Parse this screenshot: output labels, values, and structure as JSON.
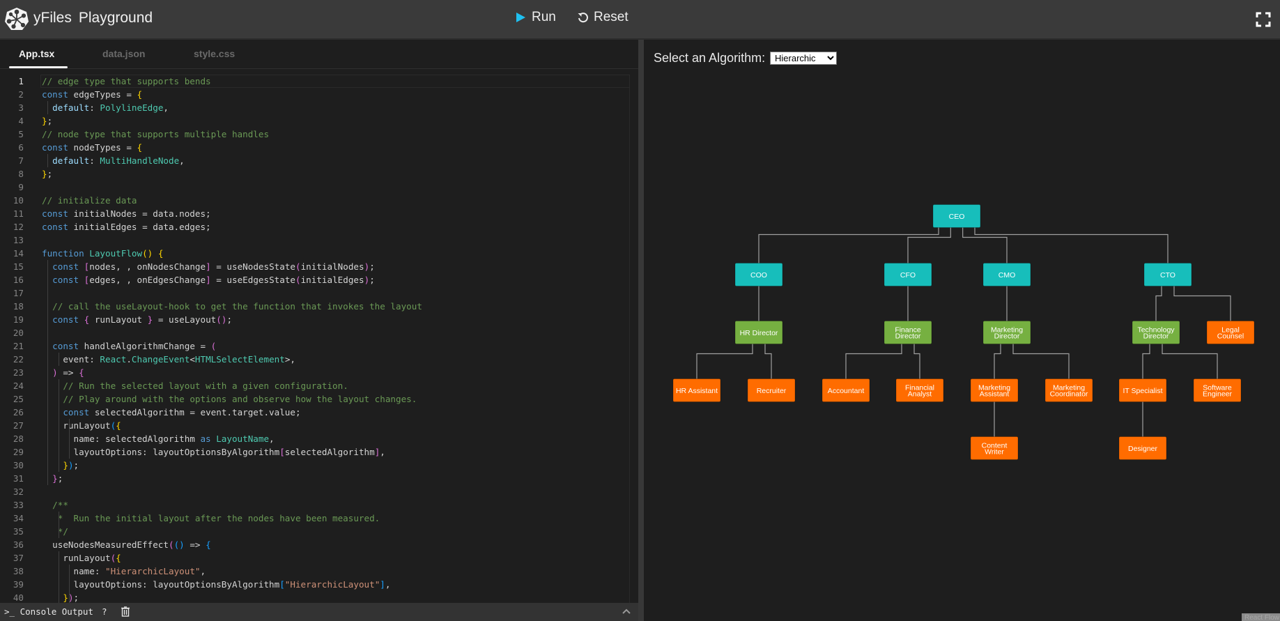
{
  "header": {
    "brand_part1": "yFiles",
    "brand_part2": "Playground",
    "run_label": "Run",
    "reset_label": "Reset",
    "logo_icon": "yfiles-logo-icon",
    "run_icon": "play-icon",
    "reset_icon": "reset-icon",
    "fullscreen_icon": "fullscreen-icon"
  },
  "editor": {
    "tabs": [
      {
        "label": "App.tsx",
        "active": true
      },
      {
        "label": "data.json",
        "active": false
      },
      {
        "label": "style.css",
        "active": false
      }
    ],
    "current_line": 1,
    "lines": [
      [
        [
          "c-com",
          "// edge type that supports bends"
        ]
      ],
      [
        [
          "c-kw",
          "const"
        ],
        [
          "",
          "edgeTypes = "
        ],
        [
          "c-b1",
          "{"
        ]
      ],
      [
        [
          "",
          "  "
        ],
        [
          "c-var",
          "default"
        ],
        [
          "",
          ": "
        ],
        [
          "c-type",
          "PolylineEdge"
        ],
        [
          "",
          ","
        ]
      ],
      [
        [
          "c-b1",
          "}"
        ],
        [
          "",
          ";"
        ]
      ],
      [
        [
          "c-com",
          "// node type that supports multiple handles"
        ]
      ],
      [
        [
          "c-kw",
          "const"
        ],
        [
          "",
          "nodeTypes = "
        ],
        [
          "c-b1",
          "{"
        ]
      ],
      [
        [
          "",
          "  "
        ],
        [
          "c-var",
          "default"
        ],
        [
          "",
          ": "
        ],
        [
          "c-type",
          "MultiHandleNode"
        ],
        [
          "",
          ","
        ]
      ],
      [
        [
          "c-b1",
          "}"
        ],
        [
          "",
          ";"
        ]
      ],
      [],
      [
        [
          "c-com",
          "// initialize data"
        ]
      ],
      [
        [
          "c-kw",
          "const"
        ],
        [
          "",
          "initialNodes = data.nodes;"
        ]
      ],
      [
        [
          "c-kw",
          "const"
        ],
        [
          "",
          "initialEdges = data.edges;"
        ]
      ],
      [],
      [
        [
          "c-kw",
          "function"
        ],
        [
          "c-type",
          " LayoutFlow"
        ],
        [
          "c-b1",
          "()"
        ],
        [
          "",
          ""
        ],
        [
          "c-b1",
          " {"
        ]
      ],
      [
        [
          "",
          "  "
        ],
        [
          "c-kw",
          "const"
        ],
        [
          "c-b2",
          " ["
        ],
        [
          "",
          "nodes, , onNodesChange"
        ],
        [
          "c-b2",
          "]"
        ],
        [
          "",
          "",
          " = useNodesState"
        ],
        [
          "c-b2",
          "("
        ],
        [
          "",
          "initialNodes"
        ],
        [
          "c-b2",
          ")"
        ],
        [
          "",
          ";"
        ]
      ],
      [
        [
          "",
          "  "
        ],
        [
          "c-kw",
          "const"
        ],
        [
          "c-b2",
          " ["
        ],
        [
          "",
          "edges, , onEdgesChange"
        ],
        [
          "c-b2",
          "]"
        ],
        [
          "",
          "",
          " = useEdgesState"
        ],
        [
          "c-b2",
          "("
        ],
        [
          "",
          "initialEdges"
        ],
        [
          "c-b2",
          ")"
        ],
        [
          "",
          ";"
        ]
      ],
      [],
      [
        [
          "",
          "  "
        ],
        [
          "c-com",
          "// call the useLayout-hook to get the function that invokes the layout"
        ]
      ],
      [
        [
          "",
          "  "
        ],
        [
          "c-kw",
          "const"
        ],
        [
          "c-b2",
          " {"
        ],
        [
          "",
          " runLayout "
        ],
        [
          "c-b2",
          "}"
        ],
        [
          "",
          " = useLayout"
        ],
        [
          "c-b2",
          "()"
        ],
        [
          "",
          ";"
        ]
      ],
      [],
      [
        [
          "",
          "  "
        ],
        [
          "c-kw",
          "const"
        ],
        [
          "",
          " handleAlgorithmChange = "
        ],
        [
          "c-b2",
          "("
        ]
      ],
      [
        [
          "",
          "    event: "
        ],
        [
          "c-type",
          "React"
        ],
        [
          "",
          "."
        ],
        [
          "c-type",
          "ChangeEvent"
        ],
        [
          "",
          "<"
        ],
        [
          "c-type",
          "HTMLSelectElement"
        ],
        [
          "",
          ">,"
        ]
      ],
      [
        [
          "",
          "  "
        ],
        [
          "c-b2",
          ")"
        ],
        [
          "",
          " => "
        ],
        [
          "c-b2",
          "{"
        ]
      ],
      [
        [
          "",
          "    "
        ],
        [
          "c-com",
          "// Run the selected layout with a given configuration."
        ]
      ],
      [
        [
          "",
          "    "
        ],
        [
          "c-com",
          "// Play around with the options and observe how the layout changes."
        ]
      ],
      [
        [
          "",
          "    "
        ],
        [
          "c-kw",
          "const"
        ],
        [
          "",
          " selectedAlgorithm = event.target.value;"
        ]
      ],
      [
        [
          "",
          "    runLayout"
        ],
        [
          "c-b3",
          "("
        ],
        [
          "c-b1",
          "{"
        ]
      ],
      [
        [
          "",
          "      name: selectedAlgorithm "
        ],
        [
          "c-kw",
          "as"
        ],
        [
          "c-type",
          " LayoutName"
        ],
        [
          "",
          ","
        ]
      ],
      [
        [
          "",
          "      layoutOptions: layoutOptionsByAlgorithm"
        ],
        [
          "c-b2",
          "["
        ],
        [
          "",
          "selectedAlgorithm"
        ],
        [
          "c-b2",
          "]"
        ],
        [
          "",
          ","
        ]
      ],
      [
        [
          "",
          "    "
        ],
        [
          "c-b1",
          "}"
        ],
        [
          "c-b3",
          ")"
        ],
        [
          "",
          ";"
        ]
      ],
      [
        [
          "",
          "  "
        ],
        [
          "c-b2",
          "}"
        ],
        [
          "",
          ";"
        ]
      ],
      [],
      [
        [
          "",
          "  "
        ],
        [
          "c-com",
          "/**"
        ]
      ],
      [
        [
          "",
          "   "
        ],
        [
          "c-com",
          "*  Run the initial layout after the nodes have been measured."
        ]
      ],
      [
        [
          "",
          "   "
        ],
        [
          "c-com",
          "*/"
        ]
      ],
      [
        [
          "",
          "  useNodesMeasuredEffect"
        ],
        [
          "c-b2",
          "("
        ],
        [
          "c-b3",
          "()"
        ],
        [
          "",
          " => "
        ],
        [
          "c-b3",
          "{"
        ]
      ],
      [
        [
          "",
          "    runLayout"
        ],
        [
          "c-b2",
          "("
        ],
        [
          "c-b1",
          "{"
        ]
      ],
      [
        [
          "",
          "      name: "
        ],
        [
          "c-str",
          "\"HierarchicLayout\""
        ],
        [
          "",
          ","
        ]
      ],
      [
        [
          "",
          "      layoutOptions: layoutOptionsByAlgorithm"
        ],
        [
          "c-b3",
          "["
        ],
        [
          "c-str",
          "\"HierarchicLayout\""
        ],
        [
          "c-b3",
          "]"
        ],
        [
          "",
          ","
        ]
      ],
      [
        [
          "",
          "    "
        ],
        [
          "c-b1",
          "}"
        ],
        [
          "c-b2",
          ")"
        ],
        [
          "",
          ";"
        ]
      ]
    ]
  },
  "console": {
    "label": ">_ Console Output",
    "help_label": "?",
    "trash_icon": "trash-icon",
    "expand_icon": "chevron-up-icon"
  },
  "graph_panel": {
    "select_label": "Select an Algorithm:",
    "selected_algorithm": "Hierarchic",
    "attribution": "React Flow",
    "colors": {
      "executive": "#17bebb",
      "director": "#76b041",
      "staff": "#ff6c00",
      "edge": "#a0a0a0"
    },
    "nodes": [
      {
        "id": "ceo",
        "label": [
          "CEO"
        ],
        "level": "executive"
      },
      {
        "id": "coo",
        "label": [
          "COO"
        ],
        "level": "executive"
      },
      {
        "id": "cfo",
        "label": [
          "CFO"
        ],
        "level": "executive"
      },
      {
        "id": "cmo",
        "label": [
          "CMO"
        ],
        "level": "executive"
      },
      {
        "id": "cto",
        "label": [
          "CTO"
        ],
        "level": "executive"
      },
      {
        "id": "hrd",
        "label": [
          "HR Director"
        ],
        "level": "director"
      },
      {
        "id": "fd",
        "label": [
          "Finance",
          "Director"
        ],
        "level": "director"
      },
      {
        "id": "md",
        "label": [
          "Marketing",
          "Director"
        ],
        "level": "director"
      },
      {
        "id": "td",
        "label": [
          "Technology",
          "Director"
        ],
        "level": "director"
      },
      {
        "id": "lc",
        "label": [
          "Legal",
          "Counsel"
        ],
        "level": "staff"
      },
      {
        "id": "hra",
        "label": [
          "HR Assistant"
        ],
        "level": "staff"
      },
      {
        "id": "rec",
        "label": [
          "Recruiter"
        ],
        "level": "staff"
      },
      {
        "id": "acc",
        "label": [
          "Accountant"
        ],
        "level": "staff"
      },
      {
        "id": "fa",
        "label": [
          "Financial",
          "Analyst"
        ],
        "level": "staff"
      },
      {
        "id": "ma",
        "label": [
          "Marketing",
          "Assistant"
        ],
        "level": "staff"
      },
      {
        "id": "mc",
        "label": [
          "Marketing",
          "Coordinator"
        ],
        "level": "staff"
      },
      {
        "id": "its",
        "label": [
          "IT Specialist"
        ],
        "level": "staff"
      },
      {
        "id": "se",
        "label": [
          "Software",
          "Engineer"
        ],
        "level": "staff"
      },
      {
        "id": "cw",
        "label": [
          "Content",
          "Writer"
        ],
        "level": "staff"
      },
      {
        "id": "des",
        "label": [
          "Designer"
        ],
        "level": "staff"
      }
    ],
    "edges": [
      [
        "ceo",
        "coo"
      ],
      [
        "ceo",
        "cfo"
      ],
      [
        "ceo",
        "cmo"
      ],
      [
        "ceo",
        "cto"
      ],
      [
        "coo",
        "hrd"
      ],
      [
        "cfo",
        "fd"
      ],
      [
        "cmo",
        "md"
      ],
      [
        "cto",
        "td"
      ],
      [
        "cto",
        "lc"
      ],
      [
        "hrd",
        "hra"
      ],
      [
        "hrd",
        "rec"
      ],
      [
        "fd",
        "acc"
      ],
      [
        "fd",
        "fa"
      ],
      [
        "md",
        "ma"
      ],
      [
        "md",
        "mc"
      ],
      [
        "td",
        "its"
      ],
      [
        "td",
        "se"
      ],
      [
        "ma",
        "cw"
      ],
      [
        "its",
        "des"
      ]
    ]
  }
}
